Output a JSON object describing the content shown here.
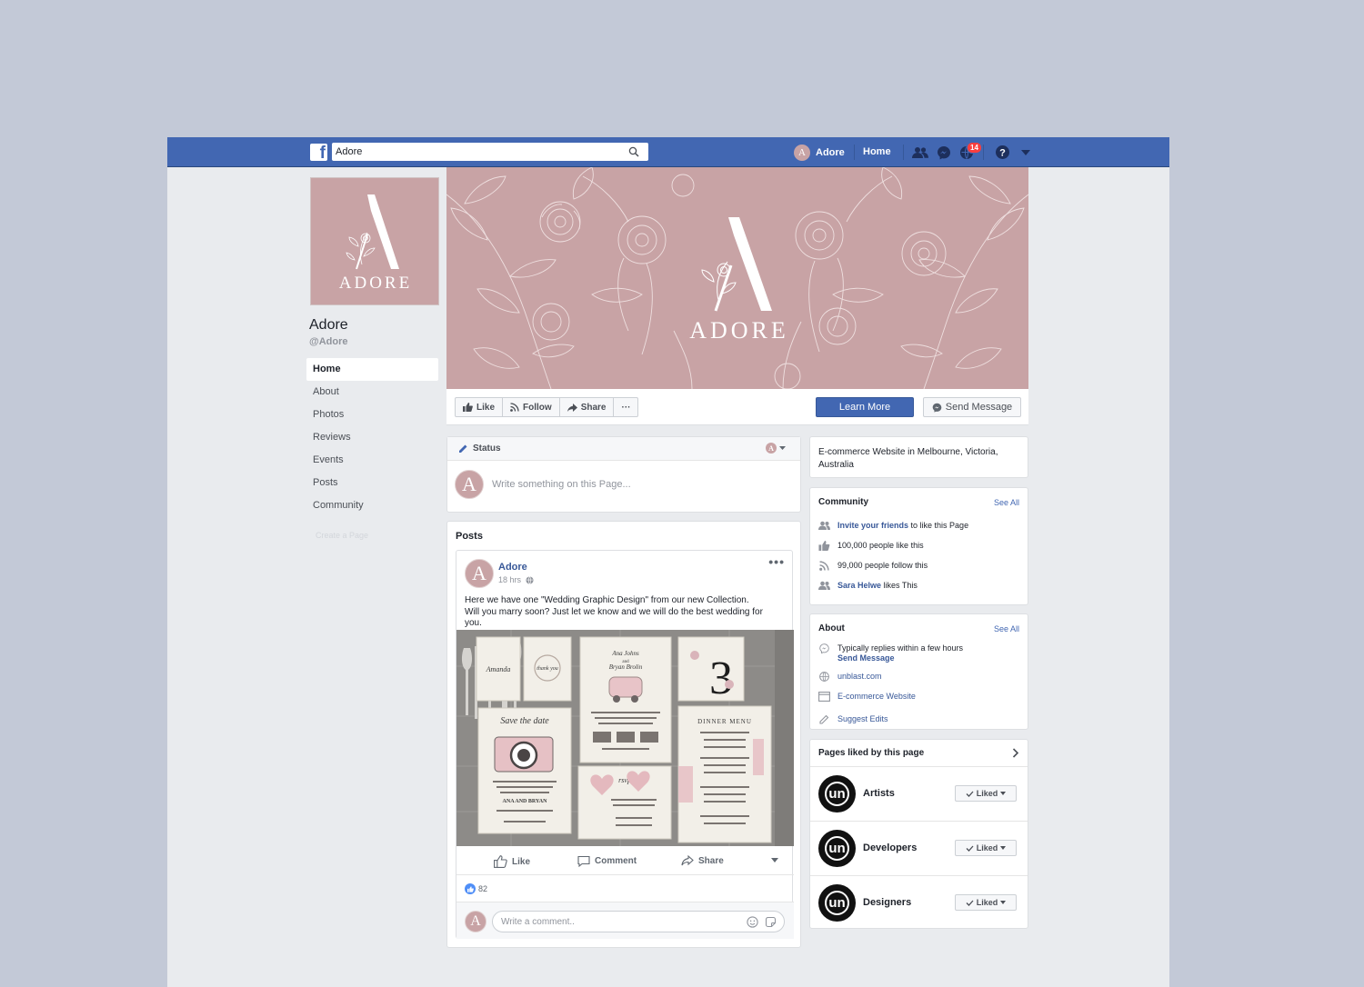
{
  "topbar": {
    "search_value": "Adore",
    "profile_initial": "A",
    "profile_name": "Adore",
    "home_label": "Home",
    "notification_count": "14"
  },
  "page": {
    "name": "Adore",
    "handle": "@Adore",
    "logo_letter": "A",
    "logo_word": "ADORE"
  },
  "nav": {
    "items": [
      "Home",
      "About",
      "Photos",
      "Reviews",
      "Events",
      "Posts",
      "Community"
    ],
    "create_page": "Create a Page"
  },
  "action_bar": {
    "like": "Like",
    "follow": "Follow",
    "share": "Share",
    "more": "···",
    "learn_more": "Learn More",
    "send_message": "Send Message"
  },
  "composer": {
    "tab_label": "Status",
    "placeholder": "Write something on this Page..."
  },
  "posts": {
    "title": "Posts",
    "post": {
      "author": "Adore",
      "time": "18 hrs",
      "text": "Here we have one \"Wedding Graphic Design\" from our new Collection. Will you marry soon? Just let we know and we will do the best wedding for you.",
      "image_texts": {
        "name": "Amanda",
        "thanks": "thank you",
        "couple_top": "Ana Johns",
        "couple_and": "and",
        "couple_bottom": "Bryan Brolin",
        "table_number": "3",
        "save_the_date": "Save the date",
        "couple_caps": "ANA AND BRYAN",
        "dinner_menu": "DINNER MENU",
        "rsvp": "rsvp"
      },
      "like": "Like",
      "comment": "Comment",
      "share": "Share",
      "reaction_count": "82",
      "comment_placeholder": "Write a comment.."
    }
  },
  "sidebar": {
    "location": "E-commerce Website in Melbourne, Victoria, Australia",
    "community": {
      "title": "Community",
      "see_all": "See All",
      "invite_link": "Invite your friends",
      "invite_rest": " to like this Page",
      "likes": "100,000 people like this",
      "follows": "99,000 people follow this",
      "friend_name": "Sara Helwe",
      "friend_rest": " likes This"
    },
    "about": {
      "title": "About",
      "see_all": "See All",
      "replies": "Typically replies within a few hours",
      "send_message": "Send Message",
      "website": "unblast.com",
      "category": "E-commerce Website",
      "suggest": "Suggest Edits"
    },
    "liked": {
      "title": "Pages liked by this page",
      "logo_text": "un",
      "liked_label": "Liked",
      "pages": [
        "Artists",
        "Developers",
        "Designers"
      ]
    }
  },
  "colors": {
    "brand_blue": "#4267b2",
    "page_pink": "#c8a3a5",
    "background": "#e9ebee",
    "link": "#385898"
  }
}
